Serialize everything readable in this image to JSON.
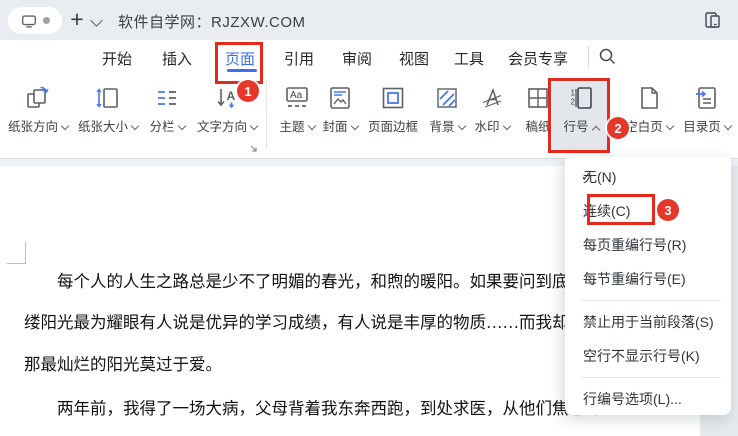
{
  "titlebar": {
    "title": "软件自学网：RJZXW.COM"
  },
  "tabs": [
    {
      "label": "开始"
    },
    {
      "label": "插入"
    },
    {
      "label": "页面",
      "active": true
    },
    {
      "label": "引用"
    },
    {
      "label": "审阅"
    },
    {
      "label": "视图"
    },
    {
      "label": "工具"
    },
    {
      "label": "会员专享"
    }
  ],
  "ribbon": {
    "buttons": [
      {
        "label": "纸张方向",
        "chevron": "down"
      },
      {
        "label": "纸张大小",
        "chevron": "down"
      },
      {
        "label": "分栏",
        "chevron": "down"
      },
      {
        "label": "文字方向",
        "chevron": "down"
      },
      {
        "label": "主题",
        "chevron": "down"
      },
      {
        "label": "封面",
        "chevron": "down"
      },
      {
        "label": "页面边框",
        "chevron": "none"
      },
      {
        "label": "背景",
        "chevron": "down"
      },
      {
        "label": "水印",
        "chevron": "down"
      },
      {
        "label": "稿纸",
        "chevron": "none"
      },
      {
        "label": "行号",
        "chevron": "up",
        "pressed": true
      },
      {
        "label": "空白页",
        "chevron": "down"
      },
      {
        "label": "目录页",
        "chevron": "down"
      }
    ]
  },
  "line_number_menu": {
    "items": [
      {
        "label": "无(N)",
        "checked": true
      },
      {
        "label": "连续(C)",
        "checked": false
      },
      {
        "label": "每页重编行号(R)",
        "checked": false
      },
      {
        "label": "每节重编行号(E)",
        "checked": false
      },
      {
        "label": "禁止用于当前段落(S)",
        "checked": false
      },
      {
        "label": "空行不显示行号(K)",
        "checked": false
      },
      {
        "label": "行编号选项(L)...",
        "checked": false
      }
    ],
    "check_glyph": "✓"
  },
  "document": {
    "paragraphs": [
      "每个人的人生之路总是少不了明媚的春光，和煦的暖阳。如果要问到底哪",
      "缕阳光最为耀眼有人说是优异的学习成绩，有人说是丰厚的物质……而我却认",
      "那最灿烂的阳光莫过于爱。",
      "两年前，我得了一场大病，父母背着我东奔西跑，到处求医，从他们焦急的"
    ]
  },
  "annotations": {
    "step1": "1",
    "step2": "2",
    "step3": "3"
  },
  "colors": {
    "accent_blue": "#3f6ef5",
    "icon_blue": "#4478f2",
    "annotation_red": "#e6291d",
    "titlebar_bg": "#e9edf1"
  }
}
